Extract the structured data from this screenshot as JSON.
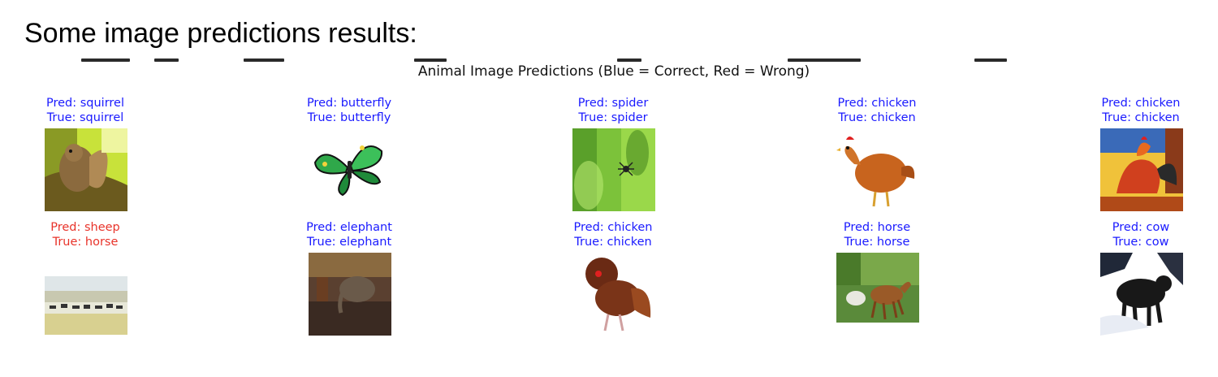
{
  "heading": "Some image predictions results:",
  "figure": {
    "title": "Animal Image Predictions (Blue = Correct, Red = Wrong)",
    "colors": {
      "correct": "#1a1aff",
      "wrong": "#e8332a"
    },
    "panels": [
      {
        "pred": "Pred: squirrel",
        "true": "True: squirrel",
        "correct": true,
        "image": "squirrel-photo"
      },
      {
        "pred": "Pred: butterfly",
        "true": "True: butterfly",
        "correct": true,
        "image": "butterfly-photo"
      },
      {
        "pred": "Pred: spider",
        "true": "True: spider",
        "correct": true,
        "image": "spider-photo"
      },
      {
        "pred": "Pred: chicken",
        "true": "True: chicken",
        "correct": true,
        "image": "hen-photo"
      },
      {
        "pred": "Pred: chicken",
        "true": "True: chicken",
        "correct": true,
        "image": "rooster-painting"
      },
      {
        "pred": "Pred: sheep",
        "true": "True: horse",
        "correct": false,
        "image": "horse-herd-photo"
      },
      {
        "pred": "Pred: elephant",
        "true": "True: elephant",
        "correct": true,
        "image": "elephant-photo"
      },
      {
        "pred": "Pred: chicken",
        "true": "True: chicken",
        "correct": true,
        "image": "silkie-rooster-photo"
      },
      {
        "pred": "Pred: horse",
        "true": "True: horse",
        "correct": true,
        "image": "horses-photo"
      },
      {
        "pred": "Pred: cow",
        "true": "True: cow",
        "correct": true,
        "image": "cow-snow-photo"
      }
    ]
  }
}
